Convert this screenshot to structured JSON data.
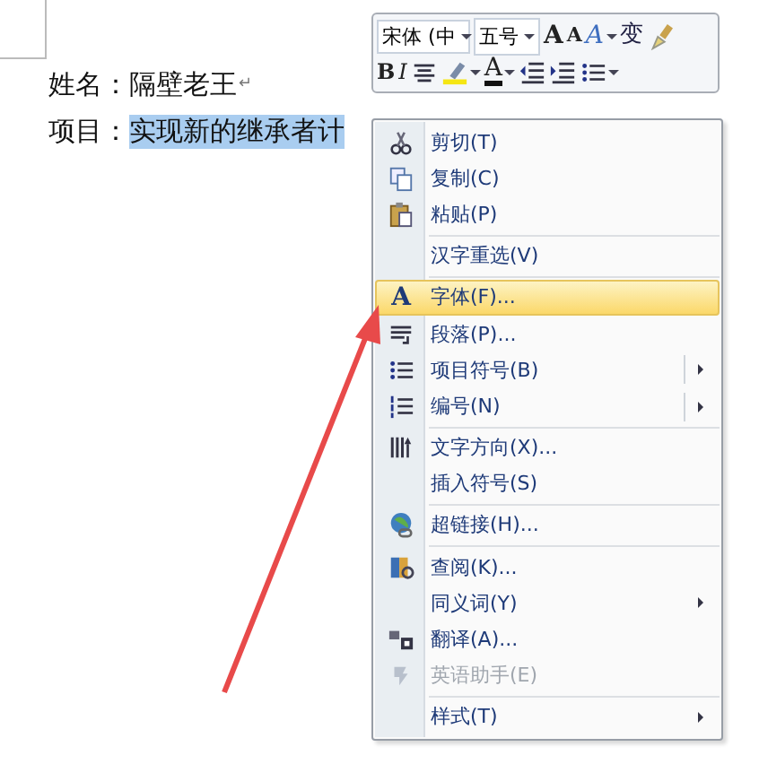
{
  "document": {
    "lines": [
      {
        "label": "姓名：",
        "value": "隔壁老王",
        "mark": "↵",
        "selected_value": false
      },
      {
        "label": "项目：",
        "value": "实现新的继承者计",
        "selected_value": true
      }
    ]
  },
  "mini_toolbar": {
    "font_field": "宋体 (中",
    "size_field": "五号",
    "glyphs": [
      "A",
      "A",
      "A",
      "变",
      "B",
      "I",
      "A"
    ]
  },
  "context_menu": {
    "items": [
      {
        "kind": "item",
        "label": "剪切(T)",
        "selected": false,
        "disabled": false,
        "submenu": false
      },
      {
        "kind": "item",
        "label": "复制(C)",
        "selected": false,
        "disabled": false,
        "submenu": false
      },
      {
        "kind": "item",
        "label": "粘贴(P)",
        "selected": false,
        "disabled": false,
        "submenu": false
      },
      {
        "kind": "separator"
      },
      {
        "kind": "item",
        "label": "汉字重选(V)",
        "selected": false,
        "disabled": false,
        "submenu": false
      },
      {
        "kind": "separator"
      },
      {
        "kind": "item",
        "label": "字体(F)...",
        "glyph": "A",
        "selected": true,
        "disabled": false,
        "submenu": false
      },
      {
        "kind": "item",
        "label": "段落(P)...",
        "selected": false,
        "disabled": false,
        "submenu": false
      },
      {
        "kind": "item",
        "label": "项目符号(B)",
        "selected": false,
        "disabled": false,
        "submenu": true,
        "split": true
      },
      {
        "kind": "item",
        "label": "编号(N)",
        "selected": false,
        "disabled": false,
        "submenu": true,
        "split": true
      },
      {
        "kind": "separator"
      },
      {
        "kind": "item",
        "label": "文字方向(X)...",
        "selected": false,
        "disabled": false,
        "submenu": false
      },
      {
        "kind": "item",
        "label": "插入符号(S)",
        "selected": false,
        "disabled": false,
        "submenu": false
      },
      {
        "kind": "separator"
      },
      {
        "kind": "item",
        "label": "超链接(H)...",
        "selected": false,
        "disabled": false,
        "submenu": false
      },
      {
        "kind": "separator"
      },
      {
        "kind": "item",
        "label": "查阅(K)...",
        "selected": false,
        "disabled": false,
        "submenu": false
      },
      {
        "kind": "item",
        "label": "同义词(Y)",
        "selected": false,
        "disabled": false,
        "submenu": true,
        "split": false
      },
      {
        "kind": "item",
        "label": "翻译(A)...",
        "selected": false,
        "disabled": false,
        "submenu": false
      },
      {
        "kind": "item",
        "label": "英语助手(E)",
        "selected": false,
        "disabled": true,
        "submenu": false
      },
      {
        "kind": "separator"
      },
      {
        "kind": "item",
        "label": "样式(T)",
        "selected": false,
        "disabled": false,
        "submenu": true,
        "split": false
      }
    ]
  }
}
